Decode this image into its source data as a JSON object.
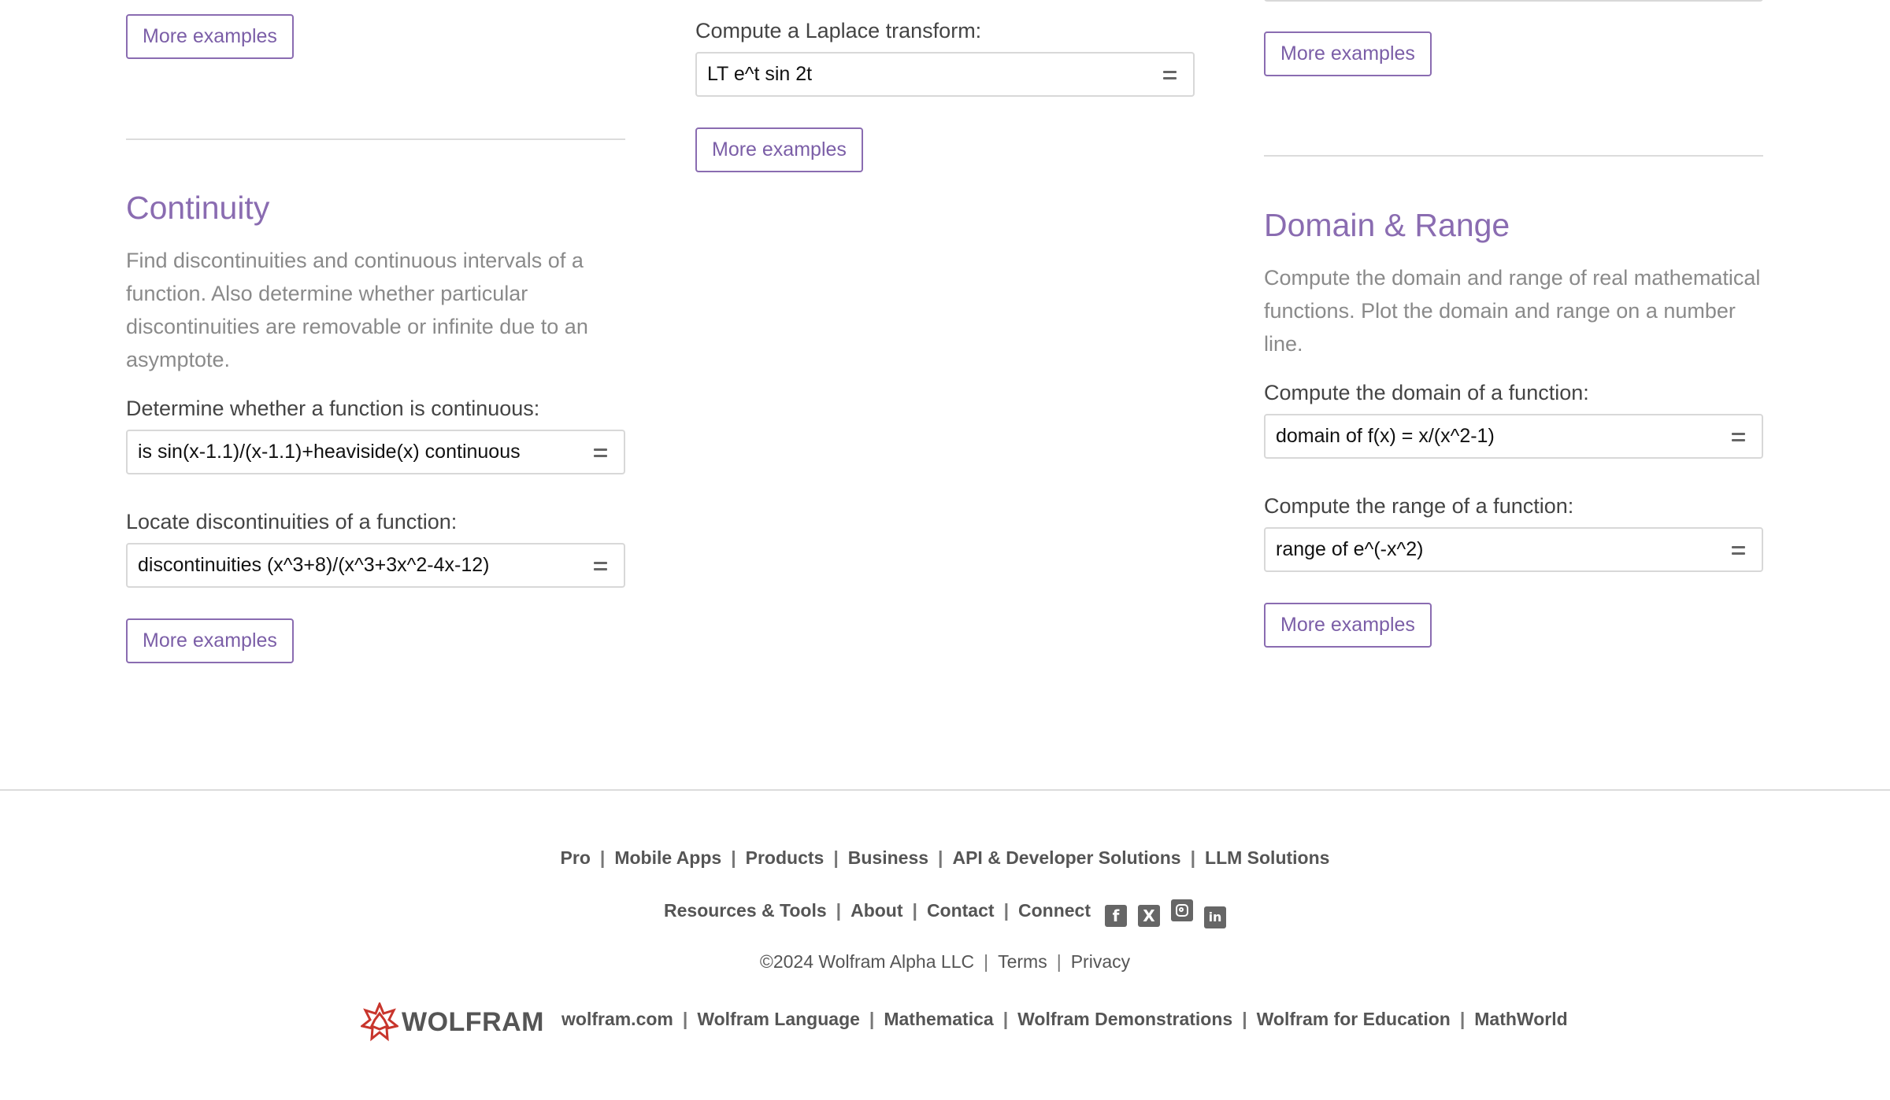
{
  "left": {
    "more_examples_top": "More examples",
    "title": "Continuity",
    "description": "Find discontinuities and continuous intervals of a function. Also determine whether particular discontinuities are removable or infinite due to an asymptote.",
    "examples": [
      {
        "label": "Determine whether a function is continuous:",
        "query": "is sin(x-1.1)/(x-1.1)+heaviside(x) continuous"
      },
      {
        "label": "Locate discontinuities of a function:",
        "query": "discontinuities (x^3+8)/(x^3+3x^2-4x-12)"
      }
    ],
    "more_examples_bottom": "More examples"
  },
  "middle": {
    "label": "Compute a Laplace transform:",
    "query": "LT e^t sin 2t",
    "more_examples": "More examples"
  },
  "right": {
    "more_examples_top": "More examples",
    "title": "Domain & Range",
    "description": "Compute the domain and range of real mathematical functions. Plot the domain and range on a number line.",
    "examples": [
      {
        "label": "Compute the domain of a function:",
        "query": "domain of f(x) = x/(x^2-1)"
      },
      {
        "label": "Compute the range of a function:",
        "query": "range of e^(-x^2)"
      }
    ],
    "more_examples_bottom": "More examples"
  },
  "footer": {
    "row1": [
      "Pro",
      "Mobile Apps",
      "Products",
      "Business",
      "API & Developer Solutions",
      "LLM Solutions"
    ],
    "row2": [
      "Resources & Tools",
      "About",
      "Contact",
      "Connect"
    ],
    "social_icons": [
      "facebook-icon",
      "x-icon",
      "instagram-icon",
      "linkedin-icon"
    ],
    "copyright": "©2024  Wolfram Alpha LLC",
    "legal": [
      "Terms",
      "Privacy"
    ],
    "brand_name": "WOLFRAM",
    "brand_links": [
      "wolfram.com",
      "Wolfram Language",
      "Mathematica",
      "Wolfram Demonstrations",
      "Wolfram for Education",
      "MathWorld"
    ],
    "colors": {
      "accent": "#8a6cb1",
      "brand_red": "#c8352c"
    }
  }
}
